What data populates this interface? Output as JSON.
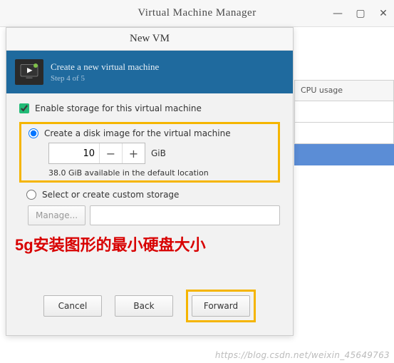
{
  "window": {
    "title": "Virtual Machine Manager"
  },
  "bg_table": {
    "header": "CPU usage"
  },
  "dialog": {
    "title": "New VM",
    "header": {
      "line1": "Create a new virtual machine",
      "line2": "Step 4 of 5"
    },
    "enable_storage_label": "Enable storage for this virtual machine",
    "create_disk_label": "Create a disk image for the virtual machine",
    "size_value": "10",
    "size_unit": "GiB",
    "available_text": "38.0 GiB available in the default location",
    "custom_storage_label": "Select or create custom storage",
    "manage_label": "Manage...",
    "buttons": {
      "cancel": "Cancel",
      "back": "Back",
      "forward": "Forward"
    }
  },
  "annotation": "5g安装图形的最小硬盘大小",
  "watermark": "https://blog.csdn.net/weixin_45649763"
}
